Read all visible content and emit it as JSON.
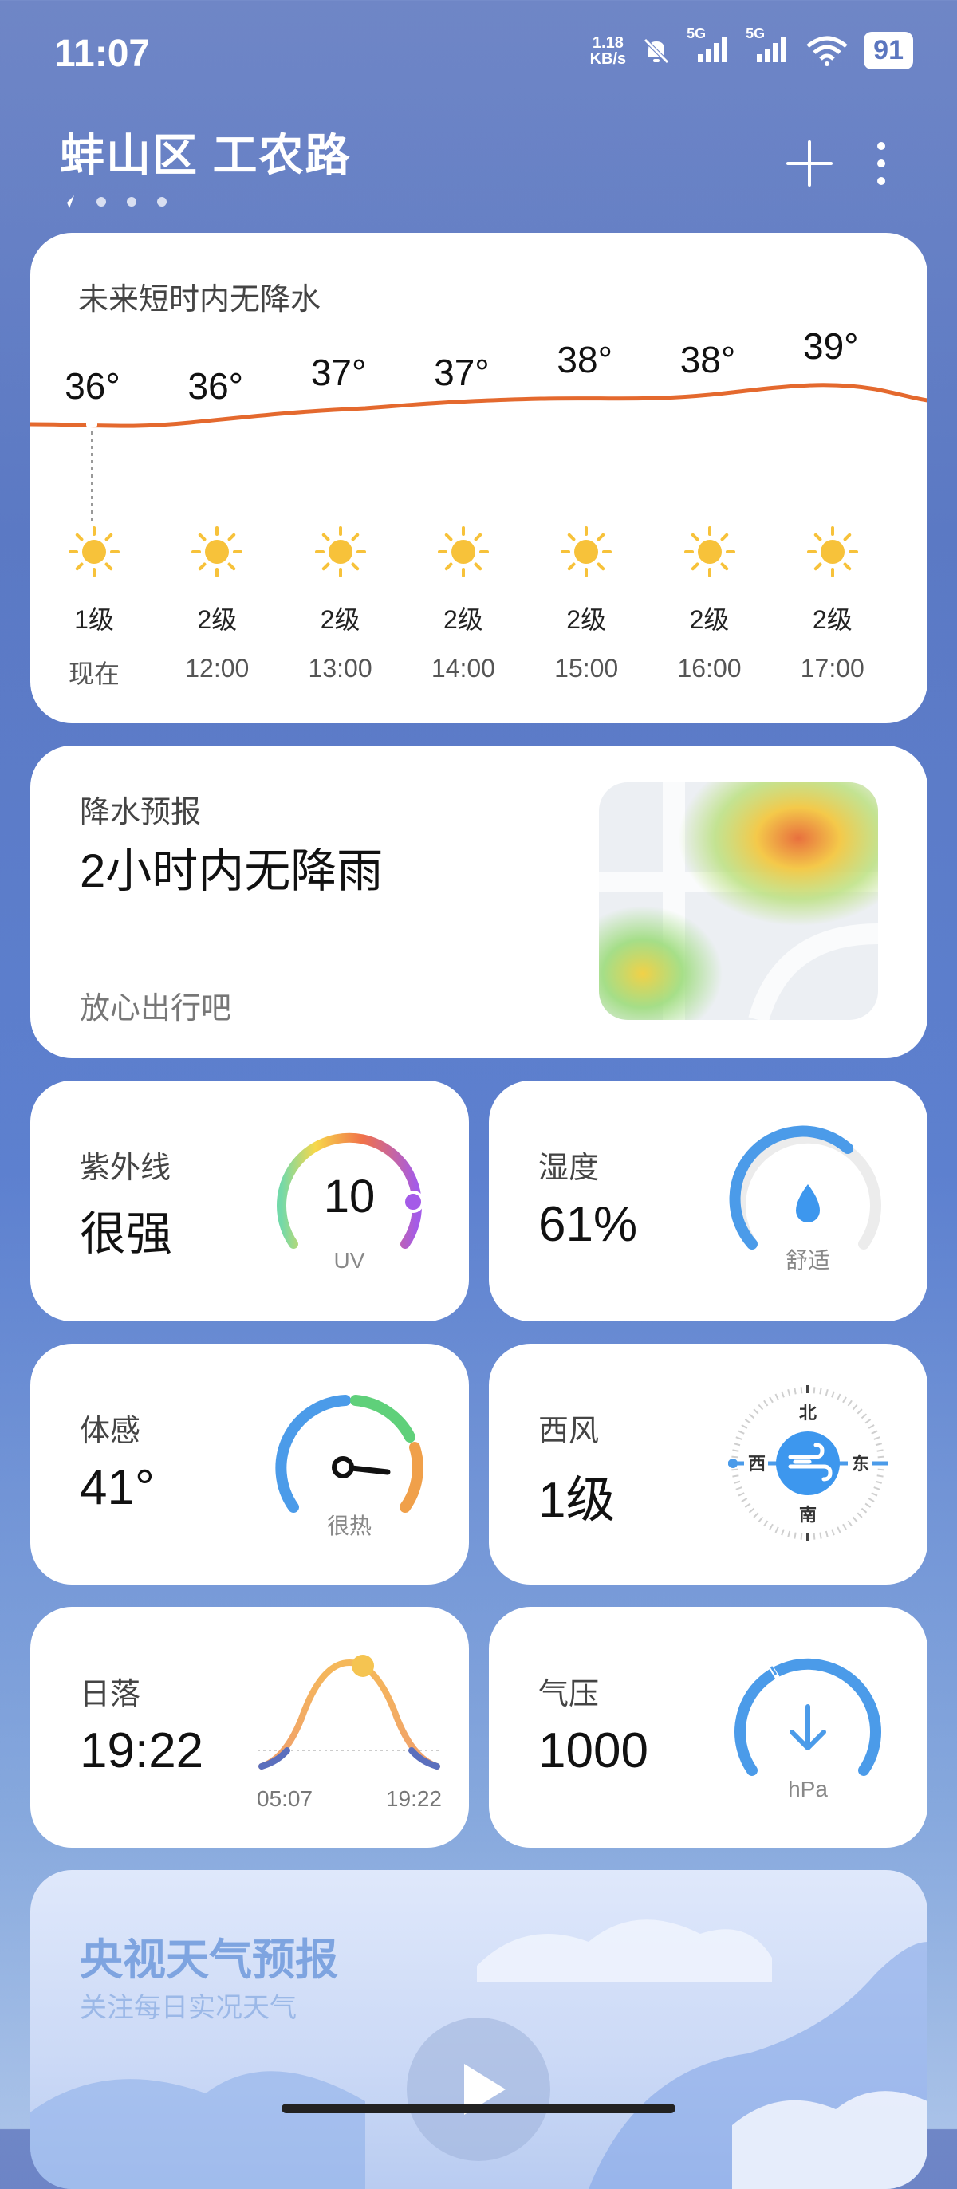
{
  "status": {
    "time": "11:07",
    "net_speed_value": "1.18",
    "net_speed_unit": "KB/s",
    "sim1": "5G",
    "sim2": "5G",
    "battery": "91"
  },
  "header": {
    "location": "蚌山区 工农路"
  },
  "hourly_card": {
    "title": "未来短时内无降水",
    "hours": [
      {
        "temp": "36°",
        "wind": "1级",
        "time": "现在"
      },
      {
        "temp": "36°",
        "wind": "2级",
        "time": "12:00"
      },
      {
        "temp": "37°",
        "wind": "2级",
        "time": "13:00"
      },
      {
        "temp": "37°",
        "wind": "2级",
        "time": "14:00"
      },
      {
        "temp": "38°",
        "wind": "2级",
        "time": "15:00"
      },
      {
        "temp": "38°",
        "wind": "2级",
        "time": "16:00"
      },
      {
        "temp": "39°",
        "wind": "2级",
        "time": "17:00"
      }
    ],
    "line_color": "#e4692e"
  },
  "precip_card": {
    "label": "降水预报",
    "headline": "2小时内无降雨",
    "note": "放心出行吧"
  },
  "uv": {
    "label": "紫外线",
    "value": "很强",
    "index": "10",
    "unit": "UV"
  },
  "humidity": {
    "label": "湿度",
    "value": "61%",
    "comfort": "舒适",
    "percent": 61
  },
  "feels": {
    "label": "体感",
    "value": "41°",
    "desc": "很热"
  },
  "wind": {
    "label": "西风",
    "value": "1级",
    "north": "北",
    "south": "南",
    "east": "东",
    "west": "西"
  },
  "sunset": {
    "label": "日落",
    "value": "19:22",
    "sunrise_time": "05:07",
    "sunset_time": "19:22"
  },
  "pressure": {
    "label": "气压",
    "value": "1000",
    "unit": "hPa"
  },
  "video_card": {
    "title": "央视天气预报",
    "subtitle": "关注每日实况天气"
  },
  "colors": {
    "accent": "#4b9be9",
    "sun": "#f7c23a"
  }
}
